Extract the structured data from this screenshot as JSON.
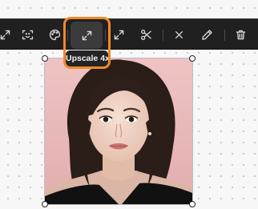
{
  "toolbar": {
    "tools": [
      {
        "name": "expand",
        "icon": "expand-icon"
      },
      {
        "name": "face-detect",
        "icon": "face-scan-icon"
      },
      {
        "name": "color-palette",
        "icon": "palette-icon"
      },
      {
        "name": "upscale",
        "icon": "upscale-arrows-icon",
        "selected": true
      },
      {
        "name": "crop-expand",
        "icon": "crop-expand-icon"
      },
      {
        "name": "cut",
        "icon": "scissors-icon"
      },
      {
        "name": "close",
        "icon": "close-icon"
      },
      {
        "name": "edit",
        "icon": "pencil-icon"
      },
      {
        "name": "delete",
        "icon": "trash-icon"
      }
    ],
    "tooltip_label": "Upscale 4x"
  },
  "canvas": {
    "image": "portrait-photo",
    "selected": true
  },
  "colors": {
    "toolbar_bg": "#202020",
    "selected_bg": "#3b3b3b",
    "highlight": "#f08a2a",
    "canvas_bg": "#f7f7f7",
    "portrait_bg": "#e8b8b8"
  }
}
